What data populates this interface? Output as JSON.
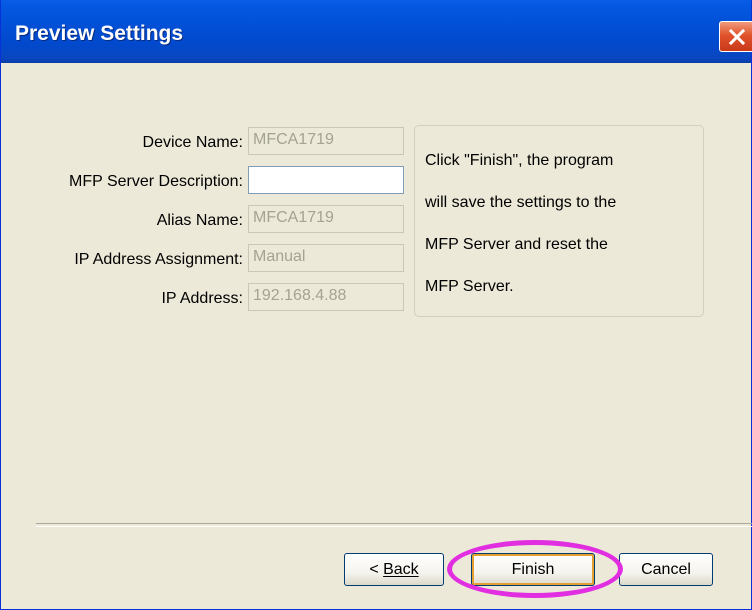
{
  "window": {
    "title": "Preview Settings"
  },
  "form": {
    "rows": [
      {
        "label": "Device Name:",
        "value": "MFCA1719"
      },
      {
        "label": "MFP Server Description:",
        "value": ""
      },
      {
        "label": "Alias Name:",
        "value": "MFCA1719"
      },
      {
        "label": "IP Address Assignment:",
        "value": "Manual"
      },
      {
        "label": "IP Address:",
        "value": "192.168.4.88"
      }
    ]
  },
  "info": {
    "lines": [
      "Click \"Finish\", the program",
      "will save the settings to the",
      "MFP Server and reset the",
      "MFP Server."
    ]
  },
  "buttons": {
    "back": "Back",
    "finish": "Finish",
    "cancel": "Cancel"
  },
  "colors": {
    "titlebar": "#0149cc",
    "close": "#e0532b",
    "highlight": "#e02ee0",
    "dialog_bg": "#ece9d8"
  }
}
